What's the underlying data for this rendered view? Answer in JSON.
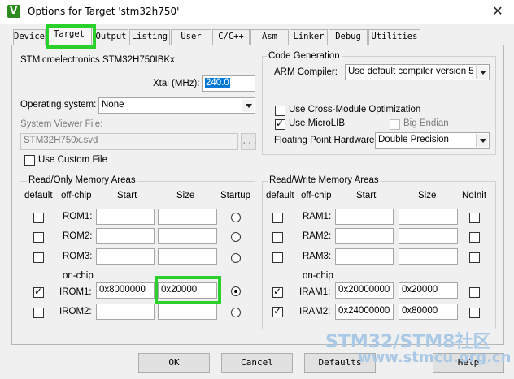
{
  "window": {
    "title": "Options for Target 'stm32h750'",
    "close": "✕"
  },
  "tabs": [
    {
      "label": "Device"
    },
    {
      "label": "Target"
    },
    {
      "label": "Output"
    },
    {
      "label": "Listing"
    },
    {
      "label": "User"
    },
    {
      "label": "C/C++"
    },
    {
      "label": "Asm"
    },
    {
      "label": "Linker"
    },
    {
      "label": "Debug"
    },
    {
      "label": "Utilities"
    }
  ],
  "target": {
    "device_name": "STMicroelectronics STM32H750IBKx",
    "xtal_label": "Xtal (MHz):",
    "xtal_value": "240.0",
    "os_label": "Operating system:",
    "os_value": "None",
    "svf_label": "System Viewer File:",
    "svf_value": "STM32H750x.svd",
    "browse_label": "...",
    "custom_file_label": "Use Custom File"
  },
  "codegen": {
    "title": "Code Generation",
    "compiler_label": "ARM Compiler:",
    "compiler_value": "Use default compiler version 5",
    "cross_module_label": "Use Cross-Module Optimization",
    "microlib_label": "Use MicroLIB",
    "big_endian_label": "Big Endian",
    "fph_label": "Floating Point Hardware:",
    "fph_value": "Double Precision"
  },
  "rom_area": {
    "title": "Read/Only Memory Areas",
    "headers": {
      "default": "default",
      "offchip": "off-chip",
      "start": "Start",
      "size": "Size",
      "startup": "Startup"
    },
    "onchip_label": "on-chip",
    "rows": [
      {
        "name": "ROM1:",
        "start": "",
        "size": "",
        "default": false,
        "startup": false
      },
      {
        "name": "ROM2:",
        "start": "",
        "size": "",
        "default": false,
        "startup": false
      },
      {
        "name": "ROM3:",
        "start": "",
        "size": "",
        "default": false,
        "startup": false
      },
      {
        "name": "IROM1:",
        "start": "0x8000000",
        "size": "0x20000",
        "default": true,
        "startup": true
      },
      {
        "name": "IROM2:",
        "start": "",
        "size": "",
        "default": false,
        "startup": false
      }
    ]
  },
  "ram_area": {
    "title": "Read/Write Memory Areas",
    "headers": {
      "default": "default",
      "offchip": "off-chip",
      "start": "Start",
      "size": "Size",
      "noinit": "NoInit"
    },
    "onchip_label": "on-chip",
    "rows": [
      {
        "name": "RAM1:",
        "start": "",
        "size": "",
        "default": false,
        "noinit": false
      },
      {
        "name": "RAM2:",
        "start": "",
        "size": "",
        "default": false,
        "noinit": false
      },
      {
        "name": "RAM3:",
        "start": "",
        "size": "",
        "default": false,
        "noinit": false
      },
      {
        "name": "IRAM1:",
        "start": "0x20000000",
        "size": "0x20000",
        "default": true,
        "noinit": false
      },
      {
        "name": "IRAM2:",
        "start": "0x24000000",
        "size": "0x80000",
        "default": true,
        "noinit": false
      }
    ]
  },
  "buttons": {
    "ok": "OK",
    "cancel": "Cancel",
    "defaults": "Defaults",
    "help": "Help"
  },
  "watermark": {
    "line1": "STM32/STM8社区",
    "line2": "www.stmcu.org.cn"
  }
}
